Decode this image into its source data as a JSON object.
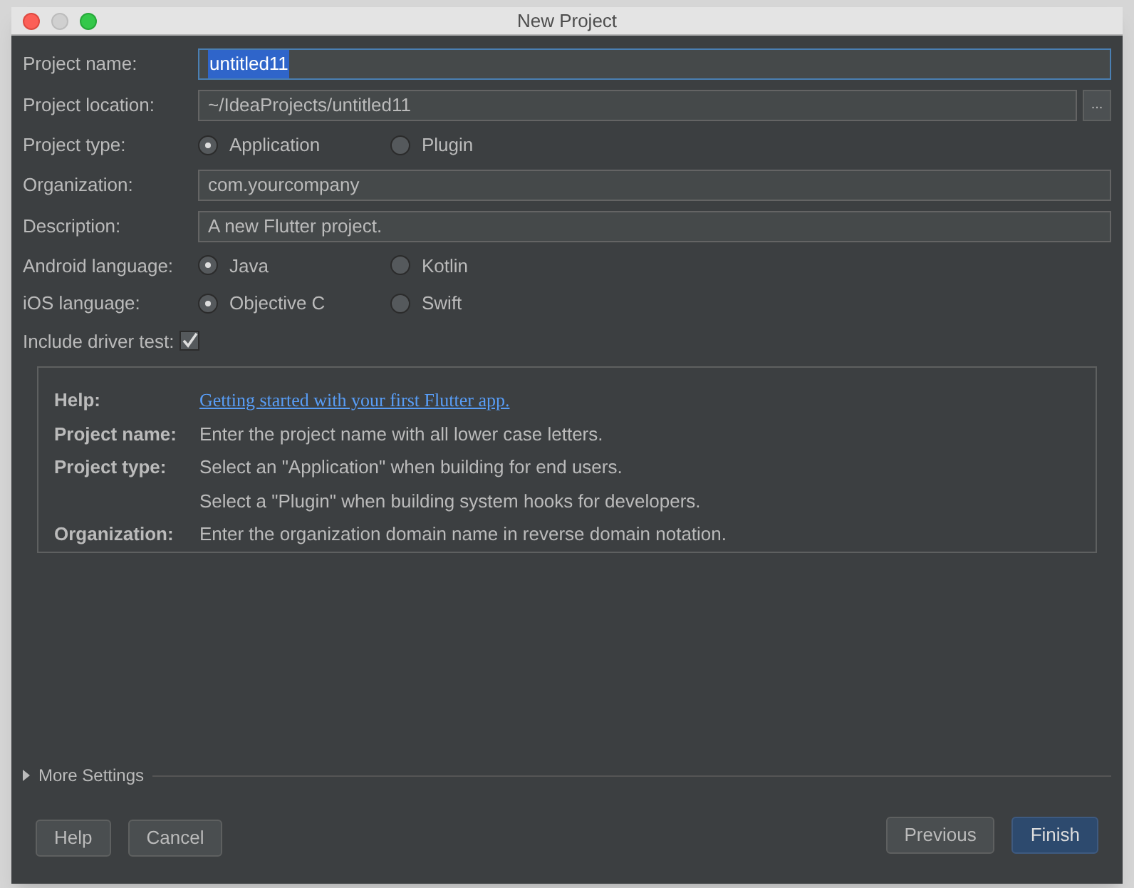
{
  "window": {
    "title": "New Project"
  },
  "fields": [
    {
      "kind": "text",
      "label": "Project name:",
      "value": "untitled11",
      "focused": true
    },
    {
      "kind": "path",
      "label": "Project location:",
      "value": "~/IdeaProjects/untitled11",
      "focused": false,
      "browse": "..."
    },
    {
      "kind": "radio",
      "label": "Project type:",
      "options": [
        {
          "label": "Application",
          "selected": true
        },
        {
          "label": "Plugin",
          "selected": false
        }
      ]
    },
    {
      "kind": "text",
      "label": "Organization:",
      "value": "com.yourcompany",
      "focused": false
    },
    {
      "kind": "text",
      "label": "Description:",
      "value": "A new Flutter project.",
      "focused": false
    },
    {
      "kind": "radio",
      "label": "Android language:",
      "options": [
        {
          "label": "Java",
          "selected": true
        },
        {
          "label": "Kotlin",
          "selected": false
        }
      ]
    },
    {
      "kind": "radio",
      "label": "iOS language:",
      "options": [
        {
          "label": "Objective C",
          "selected": true
        },
        {
          "label": "Swift",
          "selected": false
        }
      ]
    },
    {
      "kind": "checkbox",
      "label": "Include driver test:",
      "checked": true
    }
  ],
  "help": {
    "label": "Help:",
    "link": "Getting started with your first Flutter app.",
    "entries": [
      {
        "label": "Project name:",
        "lines": [
          "Enter the project name with all lower case letters."
        ]
      },
      {
        "label": "Project type:",
        "lines": [
          "Select an \"Application\" when building for end users.",
          "Select a \"Plugin\" when building system hooks for developers."
        ]
      },
      {
        "label": "Organization:",
        "lines": [
          "Enter the organization domain name in reverse domain notation."
        ]
      }
    ]
  },
  "more_settings": {
    "label": "More Settings",
    "expanded": false
  },
  "buttons_left": [
    {
      "label": "Help",
      "default": false
    },
    {
      "label": "Cancel",
      "default": false
    }
  ],
  "buttons_right": [
    {
      "label": "Previous",
      "default": false
    },
    {
      "label": "Finish",
      "default": true
    }
  ]
}
